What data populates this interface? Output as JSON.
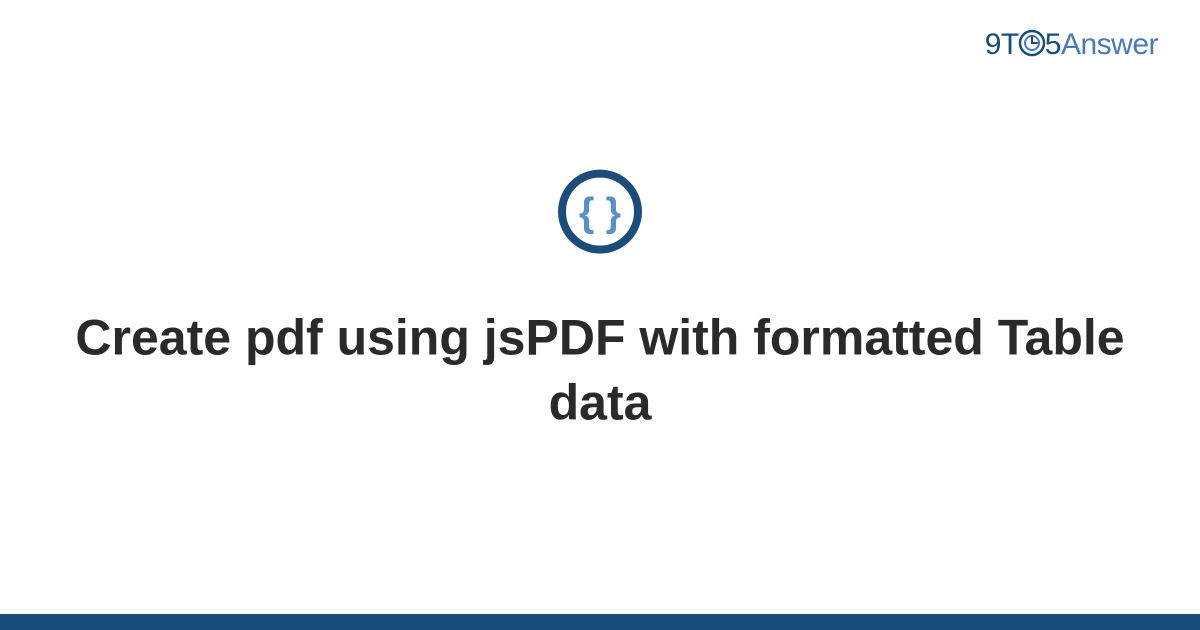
{
  "brand": {
    "part1": "9T",
    "part2": "5",
    "part3": "Answer"
  },
  "icon": {
    "name": "code-braces-icon"
  },
  "title": "Create pdf using jsPDF with formatted Table data",
  "colors": {
    "brand_dark": "#1a4d7a",
    "brand_light": "#4a7ab8",
    "text": "#2a2a2a"
  }
}
